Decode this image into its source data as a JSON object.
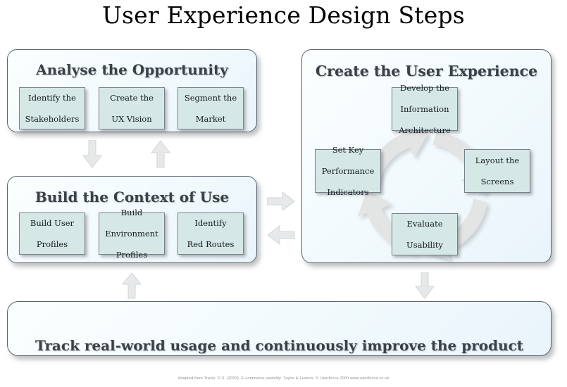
{
  "title": "User Experience Design Steps",
  "colors": {
    "box_fill": "#d5e8e6",
    "box_border": "#77808a",
    "panel_border": "#5c6470",
    "panel_fill": "#f4fbfd",
    "heading_text": "#3b4148",
    "arrow_gray": "#e0e1e1",
    "title_text": "#000000",
    "footer_text": "#8d9094"
  },
  "panels": {
    "analyse": {
      "heading": "Analyse the Opportunity",
      "boxes": [
        {
          "line1": "Identify the",
          "line2": "Stakeholders",
          "line3": ""
        },
        {
          "line1": "Create the",
          "line2": "UX Vision",
          "line3": ""
        },
        {
          "line1": "Segment the",
          "line2": "Market",
          "line3": ""
        }
      ]
    },
    "context": {
      "heading": "Build the Context of Use",
      "boxes": [
        {
          "line1": "Build User",
          "line2": "Profiles",
          "line3": ""
        },
        {
          "line1": "Build",
          "line2": "Environment",
          "line3": "Profiles"
        },
        {
          "line1": "Identify",
          "line2": "Red Routes",
          "line3": ""
        }
      ]
    },
    "create": {
      "heading": "Create the User Experience",
      "boxes": [
        {
          "line1": "Develop the",
          "line2": "Information",
          "line3": "Architecture"
        },
        {
          "line1": "Layout the",
          "line2": "Screens",
          "line3": ""
        },
        {
          "line1": "Evaluate",
          "line2": "Usability",
          "line3": ""
        },
        {
          "line1": "Set Key",
          "line2": "Performance",
          "line3": "Indicators"
        }
      ]
    }
  },
  "banner": {
    "text": "Track real-world usage and continuously improve the product"
  },
  "connectors": [
    {
      "name": "arrow-analyse-to-context",
      "direction": "down"
    },
    {
      "name": "arrow-context-to-analyse",
      "direction": "up"
    },
    {
      "name": "arrow-context-to-create",
      "direction": "right"
    },
    {
      "name": "arrow-create-to-context",
      "direction": "left"
    },
    {
      "name": "arrow-banner-to-context",
      "direction": "up"
    },
    {
      "name": "arrow-create-to-banner",
      "direction": "down"
    }
  ],
  "cycle": {
    "direction": "clockwise",
    "segments": 4
  },
  "footer": {
    "part1": "Adapted from Travis, D.S. (2003).",
    "part2": "E-commerce usability",
    "part3": ". Taylor & Francis. © Userfocus 2009 www.userfocus.co.uk"
  }
}
